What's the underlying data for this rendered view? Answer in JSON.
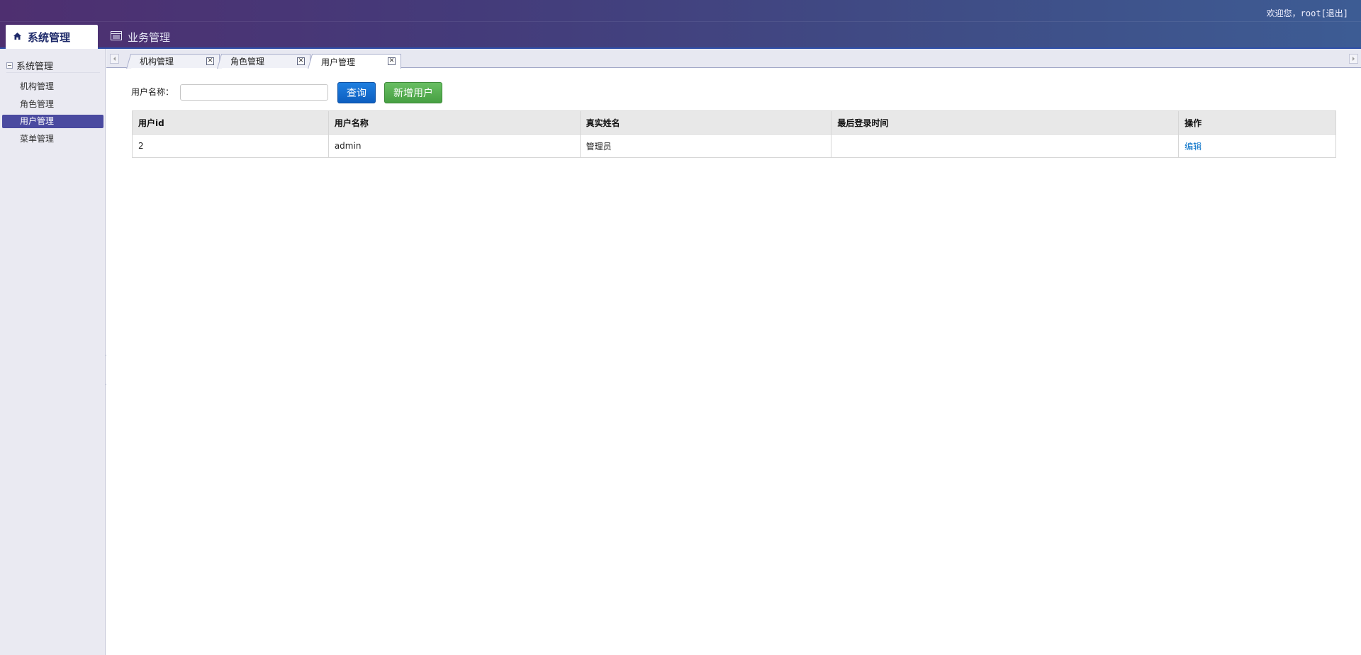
{
  "header": {
    "welcome_prefix": "欢迎您，root",
    "logout_label": "[退出]",
    "nav_tabs": [
      {
        "label": "系统管理",
        "icon": "home-icon",
        "active": true
      },
      {
        "label": "业务管理",
        "icon": "list-window-icon",
        "active": false
      }
    ]
  },
  "sidebar": {
    "group_label": "系统管理",
    "items": [
      {
        "label": "机构管理",
        "active": false
      },
      {
        "label": "角色管理",
        "active": false
      },
      {
        "label": "用户管理",
        "active": true
      },
      {
        "label": "菜单管理",
        "active": false
      }
    ]
  },
  "tabs": [
    {
      "label": "机构管理",
      "active": false
    },
    {
      "label": "角色管理",
      "active": false
    },
    {
      "label": "用户管理",
      "active": true
    }
  ],
  "search": {
    "label": "用户名称：",
    "value": "",
    "placeholder": "",
    "query_label": "查询",
    "add_label": "新增用户"
  },
  "table": {
    "columns": [
      "用户id",
      "用户名称",
      "真实姓名",
      "最后登录时间",
      "操作"
    ],
    "rows": [
      {
        "id": "2",
        "username": "admin",
        "realname": "管理员",
        "last_login": "",
        "action": "编辑"
      }
    ]
  },
  "colors": {
    "header_start": "#4e2f70",
    "header_end": "#3d5c94",
    "sidebar_active": "#4a4aa0",
    "query_button": "#0d5ec0",
    "add_button": "#47a043",
    "link": "#0a73c9"
  }
}
